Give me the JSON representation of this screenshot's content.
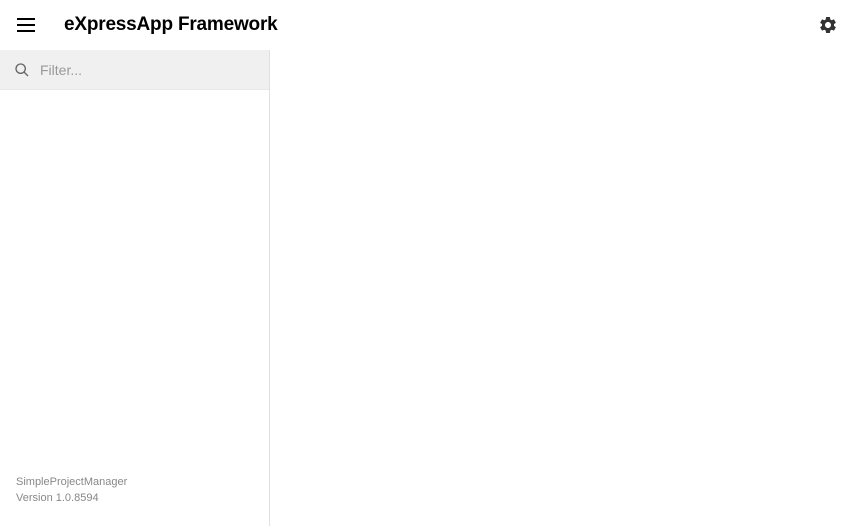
{
  "header": {
    "title": "eXpressApp Framework"
  },
  "sidebar": {
    "search": {
      "placeholder": "Filter...",
      "value": ""
    },
    "footer": {
      "appName": "SimpleProjectManager",
      "version": "Version 1.0.8594"
    }
  }
}
